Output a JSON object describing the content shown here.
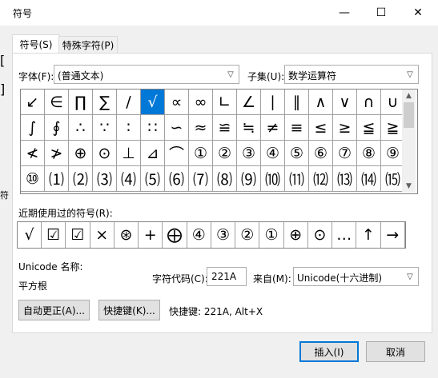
{
  "window": {
    "title": "符号",
    "minimize_glyph": "—",
    "maximize_glyph": "☐",
    "close_glyph": "✕"
  },
  "background_fragments": [
    "[",
    "]",
    "符"
  ],
  "tabs": [
    "符号(S)",
    "特殊字符(P)"
  ],
  "font": {
    "label": "字体(F):",
    "value": "(普通文本)"
  },
  "subset": {
    "label": "子集(U):",
    "value": "数学运算符"
  },
  "grid": {
    "rows": [
      [
        "↙",
        "∈",
        "∏",
        "∑",
        "∕",
        "√",
        "∝",
        "∞",
        "∟",
        "∠",
        "∣",
        "∥",
        "∧",
        "∨",
        "∩",
        "∪"
      ],
      [
        "∫",
        "∮",
        "∴",
        "∵",
        "∶",
        "∷",
        "∽",
        "≈",
        "≌",
        "≒",
        "≠",
        "≡",
        "≤",
        "≥",
        "≦",
        "≧"
      ],
      [
        "≮",
        "≯",
        "⊕",
        "⊙",
        "⊥",
        "⊿",
        "⌒",
        "①",
        "②",
        "③",
        "④",
        "⑤",
        "⑥",
        "⑦",
        "⑧",
        "⑨"
      ],
      [
        "⑩",
        "⑴",
        "⑵",
        "⑶",
        "⑷",
        "⑸",
        "⑹",
        "⑺",
        "⑻",
        "⑼",
        "⑽",
        "⑾",
        "⑿",
        "⒀",
        "⒁",
        "⒂"
      ]
    ],
    "selected_index": 5
  },
  "scrollbar": {
    "up": "▲",
    "down": "▼",
    "thumb_position": 0.0
  },
  "recent": {
    "label": "近期使用过的符号(R):",
    "symbols": [
      "√",
      "☑",
      "☑",
      "×",
      "⊛",
      "+",
      "⨁",
      "④",
      "③",
      "②",
      "①",
      "⊕",
      "⊙",
      "…",
      "↑",
      "→"
    ]
  },
  "unicode": {
    "name_label": "Unicode 名称:",
    "name_value": "平方根"
  },
  "charcode": {
    "label": "字符代码(C):",
    "value": "221A"
  },
  "from": {
    "label": "来自(M):",
    "value": "Unicode(十六进制)"
  },
  "buttons": {
    "autocorrect": "自动更正(A)...",
    "shortcut": "快捷键(K)...",
    "shortcut_info": "快捷键: 221A, Alt+X",
    "insert": "插入(I)",
    "cancel": "取消"
  },
  "colors": {
    "accent": "#0078d7",
    "dialog_bg": "#f0f0f0"
  }
}
